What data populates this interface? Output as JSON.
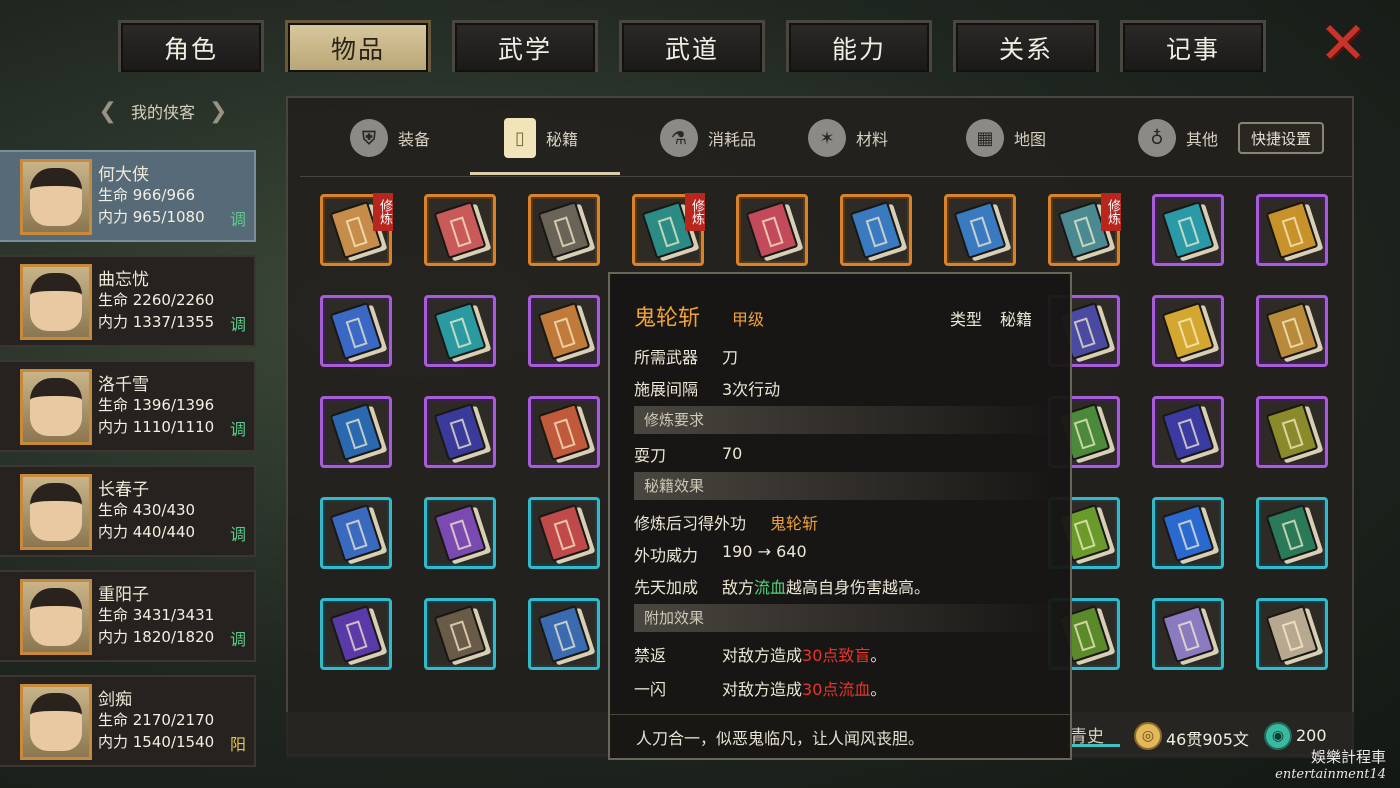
{
  "top_tabs": [
    "角色",
    "物品",
    "武学",
    "武道",
    "能力",
    "关系",
    "记事"
  ],
  "active_top_tab": 1,
  "close_glyph": "✕",
  "char_list": {
    "header": "我的侠客",
    "characters": [
      {
        "name": "何大侠",
        "hp": "生命 966/966",
        "mp": "内力 965/1080",
        "role": "调",
        "selected": true
      },
      {
        "name": "曲忘忧",
        "hp": "生命 2260/2260",
        "mp": "内力 1337/1355",
        "role": "调",
        "selected": false
      },
      {
        "name": "洛千雪",
        "hp": "生命 1396/1396",
        "mp": "内力 1110/1110",
        "role": "调",
        "selected": false
      },
      {
        "name": "长春子",
        "hp": "生命 430/430",
        "mp": "内力 440/440",
        "role": "调",
        "selected": false
      },
      {
        "name": "重阳子",
        "hp": "生命 3431/3431",
        "mp": "内力 1820/1820",
        "role": "调",
        "selected": false
      },
      {
        "name": "剑痴",
        "hp": "生命 2170/2170",
        "mp": "内力 1540/1540",
        "role": "阳",
        "selected": false
      }
    ]
  },
  "categories": [
    {
      "label": "装备",
      "icon": "armor-icon"
    },
    {
      "label": "秘籍",
      "icon": "book-icon"
    },
    {
      "label": "消耗品",
      "icon": "potion-icon"
    },
    {
      "label": "材料",
      "icon": "herb-icon"
    },
    {
      "label": "地图",
      "icon": "map-icon"
    },
    {
      "label": "其他",
      "icon": "pendant-icon"
    }
  ],
  "active_category": 1,
  "quick_settings": "快捷设置",
  "xiu_lian_badge": "修炼",
  "grid": [
    [
      "orange:#c68c4a:1",
      "orange:#c95a5a:0",
      "orange:#6a6458:0",
      "orange:#2a8c84:1",
      "orange:#c24a5a:0",
      "orange:#3a7ac0:0",
      "orange:#3a7ac0:0",
      "orange:#4a8a90:1",
      "purple:#2a9aa8:0",
      "purple:#c8922a:0"
    ],
    [
      "purple:#3a68c4:0",
      "purple:#2a9aa0:0",
      "purple:#c07a3a:0",
      "none",
      "none",
      "none",
      "none",
      "purple:#4a4aa0:0",
      "purple:#d4a830:0",
      "purple:#b88a3a:0"
    ],
    [
      "purple:#2a68b0:0",
      "purple:#3a3a9a:0",
      "purple:#c05a3a:0",
      "none",
      "none",
      "none",
      "none",
      "purple:#4a8a3a:0",
      "purple:#3a3aa0:0",
      "purple:#8a8a2a:0"
    ],
    [
      "cyan:#3a6ac0:0",
      "cyan:#7a4ab0:0",
      "cyan:#c04a4a:0",
      "none",
      "none",
      "none",
      "none",
      "cyan:#6a9a2a:0",
      "cyan:#2a6ad0:0",
      "cyan:#2a7a5a:0"
    ],
    [
      "cyan:#5a3aa8:0",
      "cyan:#6a5a48:0",
      "cyan:#3a6ab0:0",
      "none",
      "none",
      "none",
      "none",
      "cyan:#5a8a2a:0",
      "cyan:#8a7ac0:0",
      "cyan:#b8a890:0"
    ]
  ],
  "tooltip": {
    "name": "鬼轮斩",
    "grade": "甲级",
    "type_label": "类型",
    "type_value": "秘籍",
    "weapon_label": "所需武器",
    "weapon_value": "刀",
    "interval_label": "施展间隔",
    "interval_value": "3次行动",
    "req_section": "修炼要求",
    "req_skill": "耍刀",
    "req_value": "70",
    "effect_section": "秘籍效果",
    "effect_label": "修炼后习得外功",
    "effect_skill": "鬼轮斩",
    "power_label": "外功威力",
    "power_value": "190 → 640",
    "innate_label": "先天加成",
    "innate_pre": "敌方",
    "innate_hl": "流血",
    "innate_post": "越高自身伤害越高。",
    "extra_section": "附加效果",
    "extra1_label": "禁返",
    "extra1_pre": "对敌方造成",
    "extra1_hl": "30点致盲",
    "extra1_post": "。",
    "extra2_label": "一闪",
    "extra2_pre": "对敌方造成",
    "extra2_hl": "30点流血",
    "extra2_post": "。",
    "description": "人刀合一，似恶鬼临凡，让人闻风丧胆。"
  },
  "bottom": {
    "sort_label": "青史",
    "money_gold": "46贯905文",
    "money_jade": "200"
  },
  "watermark": {
    "line1": "娛樂計程車",
    "line2": "entertainment14"
  }
}
